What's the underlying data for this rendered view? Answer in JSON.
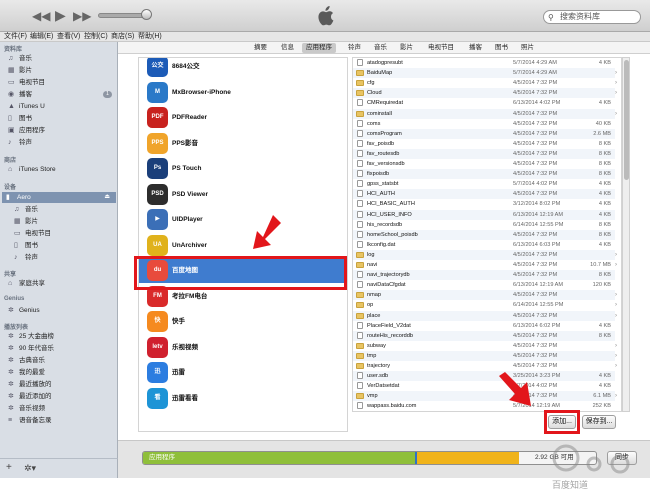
{
  "topbar": {
    "prev_icon": "rewind-icon",
    "play_icon": "play-icon",
    "next_icon": "fast-forward-icon",
    "search_placeholder": "搜索资料库"
  },
  "menu": [
    "文件(F)",
    "编辑(E)",
    "查看(V)",
    "控制(C)",
    "商店(S)",
    "帮助(H)"
  ],
  "sidebar": {
    "library_header": "资料库",
    "library": [
      {
        "label": "音乐",
        "icon": "music-note-icon"
      },
      {
        "label": "影片",
        "icon": "film-icon"
      },
      {
        "label": "电视节目",
        "icon": "tv-icon"
      },
      {
        "label": "播客",
        "icon": "podcast-icon",
        "badge": "1"
      },
      {
        "label": "iTunes U",
        "icon": "graduation-cap-icon"
      },
      {
        "label": "图书",
        "icon": "book-icon"
      },
      {
        "label": "应用程序",
        "icon": "apps-icon"
      },
      {
        "label": "铃声",
        "icon": "bell-icon"
      }
    ],
    "store_header": "商店",
    "store": [
      {
        "label": "iTunes Store",
        "icon": "store-icon"
      }
    ],
    "devices_header": "设备",
    "device": {
      "label": "Aero",
      "icon": "iphone-icon"
    },
    "device_items": [
      {
        "label": "音乐",
        "icon": "music-note-icon"
      },
      {
        "label": "影片",
        "icon": "film-icon"
      },
      {
        "label": "电视节目",
        "icon": "tv-icon"
      },
      {
        "label": "图书",
        "icon": "book-icon"
      },
      {
        "label": "铃声",
        "icon": "bell-icon"
      }
    ],
    "shared_header": "共享",
    "shared": [
      {
        "label": "家庭共享",
        "icon": "home-icon"
      }
    ],
    "genius_header": "Genius",
    "genius": [
      {
        "label": "Genius",
        "icon": "genius-icon"
      }
    ],
    "playlists_header": "播放列表",
    "playlists": [
      {
        "label": "25 大金曲榜",
        "icon": "gear-icon"
      },
      {
        "label": "90 年代音乐",
        "icon": "gear-icon"
      },
      {
        "label": "古典音乐",
        "icon": "gear-icon"
      },
      {
        "label": "我的最爱",
        "icon": "gear-icon"
      },
      {
        "label": "最近播放的",
        "icon": "gear-icon"
      },
      {
        "label": "最近添加的",
        "icon": "gear-icon"
      },
      {
        "label": "音乐视频",
        "icon": "gear-icon"
      },
      {
        "label": "语音备忘录",
        "icon": "playlist-icon"
      }
    ]
  },
  "tabs": [
    "摘要",
    "信息",
    "应用程序",
    "铃声",
    "音乐",
    "影片",
    "电视节目",
    "播客",
    "图书",
    "照片"
  ],
  "active_tab": "应用程序",
  "apps": [
    {
      "name": "8684公交",
      "icon_text": "公交",
      "color": "#1c5bb7"
    },
    {
      "name": "MxBrowser-iPhone",
      "icon_text": "M",
      "color": "#2a79c8"
    },
    {
      "name": "PDFReader",
      "icon_text": "PDF",
      "color": "#c8221e"
    },
    {
      "name": "PPS影音",
      "icon_text": "PPS",
      "color": "#f0a42a"
    },
    {
      "name": "PS Touch",
      "icon_text": "Ps",
      "color": "#1b3f7a"
    },
    {
      "name": "PSD Viewer",
      "icon_text": "PSD",
      "color": "#2d2d2d"
    },
    {
      "name": "UIDPlayer",
      "icon_text": "▶",
      "color": "#3b6fb7"
    },
    {
      "name": "UnArchiver",
      "icon_text": "UA",
      "color": "#e0b21c"
    },
    {
      "name": "百度地图",
      "icon_text": "du",
      "color": "#e84b3c",
      "selected": true
    },
    {
      "name": "考拉FM电台",
      "icon_text": "FM",
      "color": "#d92a2a"
    },
    {
      "name": "快手",
      "icon_text": "快",
      "color": "#f58a1f"
    },
    {
      "name": "乐视视频",
      "icon_text": "letv",
      "color": "#d0202e"
    },
    {
      "name": "迅雷",
      "icon_text": "迅",
      "color": "#2c7de0"
    },
    {
      "name": "迅雷看看",
      "icon_text": "看",
      "color": "#1d94d6"
    }
  ],
  "files": [
    {
      "name": "atadogpresubt",
      "date": "5/7/2014 4:29 AM",
      "size": "4 KB",
      "type": "file"
    },
    {
      "name": "BaiduMap",
      "date": "5/7/2014 4:29 AM",
      "size": "",
      "type": "folder"
    },
    {
      "name": "cfg",
      "date": "4/5/2014 7:32 PM",
      "size": "",
      "type": "folder"
    },
    {
      "name": "Cloud",
      "date": "4/5/2014 7:32 PM",
      "size": "",
      "type": "folder"
    },
    {
      "name": "CMRequiredat",
      "date": "6/13/2014 4:02 PM",
      "size": "4 KB",
      "type": "file"
    },
    {
      "name": "cominstall",
      "date": "4/5/2014 7:32 PM",
      "size": "",
      "type": "folder"
    },
    {
      "name": "coms",
      "date": "4/5/2014 7:32 PM",
      "size": "40 KB",
      "type": "file"
    },
    {
      "name": "comsProgram",
      "date": "4/5/2014 7:32 PM",
      "size": "2.6 MB",
      "type": "file"
    },
    {
      "name": "fav_poisdb",
      "date": "4/5/2014 7:32 PM",
      "size": "8 KB",
      "type": "file"
    },
    {
      "name": "fav_routesdb",
      "date": "4/5/2014 7:32 PM",
      "size": "8 KB",
      "type": "file"
    },
    {
      "name": "fav_versionsdb",
      "date": "4/5/2014 7:32 PM",
      "size": "8 KB",
      "type": "file"
    },
    {
      "name": "fixpoisdb",
      "date": "4/5/2014 7:32 PM",
      "size": "8 KB",
      "type": "file"
    },
    {
      "name": "gpss_statsbt",
      "date": "5/7/2014 4:02 PM",
      "size": "4 KB",
      "type": "file"
    },
    {
      "name": "HCI_AUTH",
      "date": "4/5/2014 7:32 PM",
      "size": "4 KB",
      "type": "file"
    },
    {
      "name": "HCI_BASIC_AUTH",
      "date": "3/12/2014 8:02 PM",
      "size": "4 KB",
      "type": "file"
    },
    {
      "name": "HCI_USER_INFO",
      "date": "6/13/2014 12:19 AM",
      "size": "4 KB",
      "type": "file"
    },
    {
      "name": "his_recordsdb",
      "date": "6/14/2014 12:55 PM",
      "size": "8 KB",
      "type": "file"
    },
    {
      "name": "homeSchool_poisdb",
      "date": "4/5/2014 7:32 PM",
      "size": "8 KB",
      "type": "file"
    },
    {
      "name": "lkconfig.dat",
      "date": "6/13/2014 6:03 PM",
      "size": "4 KB",
      "type": "file"
    },
    {
      "name": "log",
      "date": "4/5/2014 7:32 PM",
      "size": "",
      "type": "folder"
    },
    {
      "name": "navi",
      "date": "4/5/2014 7:32 PM",
      "size": "10.7 MB",
      "type": "folder"
    },
    {
      "name": "navi_trajectorydb",
      "date": "4/5/2014 7:32 PM",
      "size": "8 KB",
      "type": "file"
    },
    {
      "name": "naviDataCfgdat",
      "date": "6/13/2014 12:19 AM",
      "size": "120 KB",
      "type": "file"
    },
    {
      "name": "nmap",
      "date": "4/5/2014 7:32 PM",
      "size": "",
      "type": "folder"
    },
    {
      "name": "op",
      "date": "6/14/2014 12:55 PM",
      "size": "",
      "type": "folder"
    },
    {
      "name": "place",
      "date": "4/5/2014 7:32 PM",
      "size": "",
      "type": "folder"
    },
    {
      "name": "PlaceField_V2dat",
      "date": "6/13/2014 6:02 PM",
      "size": "4 KB",
      "type": "file"
    },
    {
      "name": "routeHis_recorddb",
      "date": "4/5/2014 7:32 PM",
      "size": "8 KB",
      "type": "file"
    },
    {
      "name": "subway",
      "date": "4/5/2014 7:32 PM",
      "size": "",
      "type": "folder"
    },
    {
      "name": "tmp",
      "date": "4/5/2014 7:32 PM",
      "size": "",
      "type": "folder"
    },
    {
      "name": "trajectory",
      "date": "4/5/2014 7:32 PM",
      "size": "",
      "type": "folder"
    },
    {
      "name": "user.sdb",
      "date": "3/25/2014 3:23 PM",
      "size": "4 KB",
      "type": "file"
    },
    {
      "name": "VerDatsetdat",
      "date": "5/7/2014 4:02 PM",
      "size": "4 KB",
      "type": "file"
    },
    {
      "name": "vmp",
      "date": "4/5/2014 7:32 PM",
      "size": "6.1 MB",
      "type": "folder"
    },
    {
      "name": "wappass.baidu.com",
      "date": "5/7/2014 12:19 AM",
      "size": "252 KB",
      "type": "file"
    }
  ],
  "buttons": {
    "add": "添加...",
    "save": "保存到..."
  },
  "capacity": {
    "label": "应用程序",
    "free": "2.92 GB 可用",
    "sync": "同步",
    "segments": [
      {
        "color": "#8fbf3a",
        "fraction": 0.6
      },
      {
        "color": "#2f72c7",
        "fraction": 0.005
      },
      {
        "color": "#f0b31a",
        "fraction": 0.225
      }
    ]
  },
  "watermark": "百度知道"
}
